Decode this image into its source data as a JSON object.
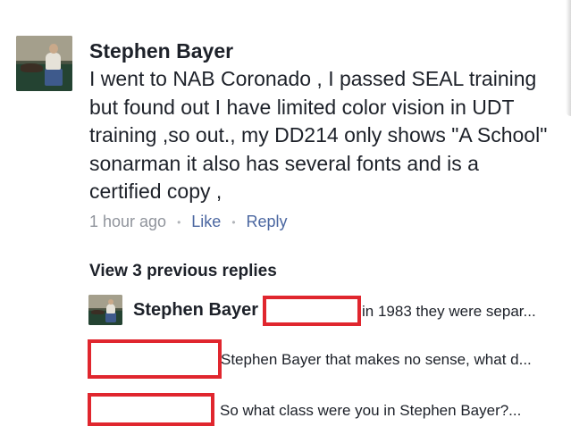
{
  "comment": {
    "author": "Stephen Bayer",
    "text": "I went to NAB Coronado , I passed SEAL training but found out I have limited color vision in UDT training ,so out., my DD214 only shows \"A School\" sonarman  it also has several fonts and is a certified copy ,",
    "time": "1 hour ago",
    "like_label": "Like",
    "reply_label": "Reply",
    "separator": "•"
  },
  "replies": {
    "view_previous_label": "View 3 previous replies",
    "items": [
      {
        "author": "Stephen Bayer",
        "text": "in 1983 they were separ..."
      },
      {
        "author": "",
        "text": "Stephen Bayer that makes no sense, what d..."
      },
      {
        "author": "",
        "text": "So what class were you in Stephen Bayer?..."
      }
    ]
  },
  "colors": {
    "text": "#1d2129",
    "meta": "#90949c",
    "link": "#4b67a1",
    "redaction": "#e0262e"
  }
}
